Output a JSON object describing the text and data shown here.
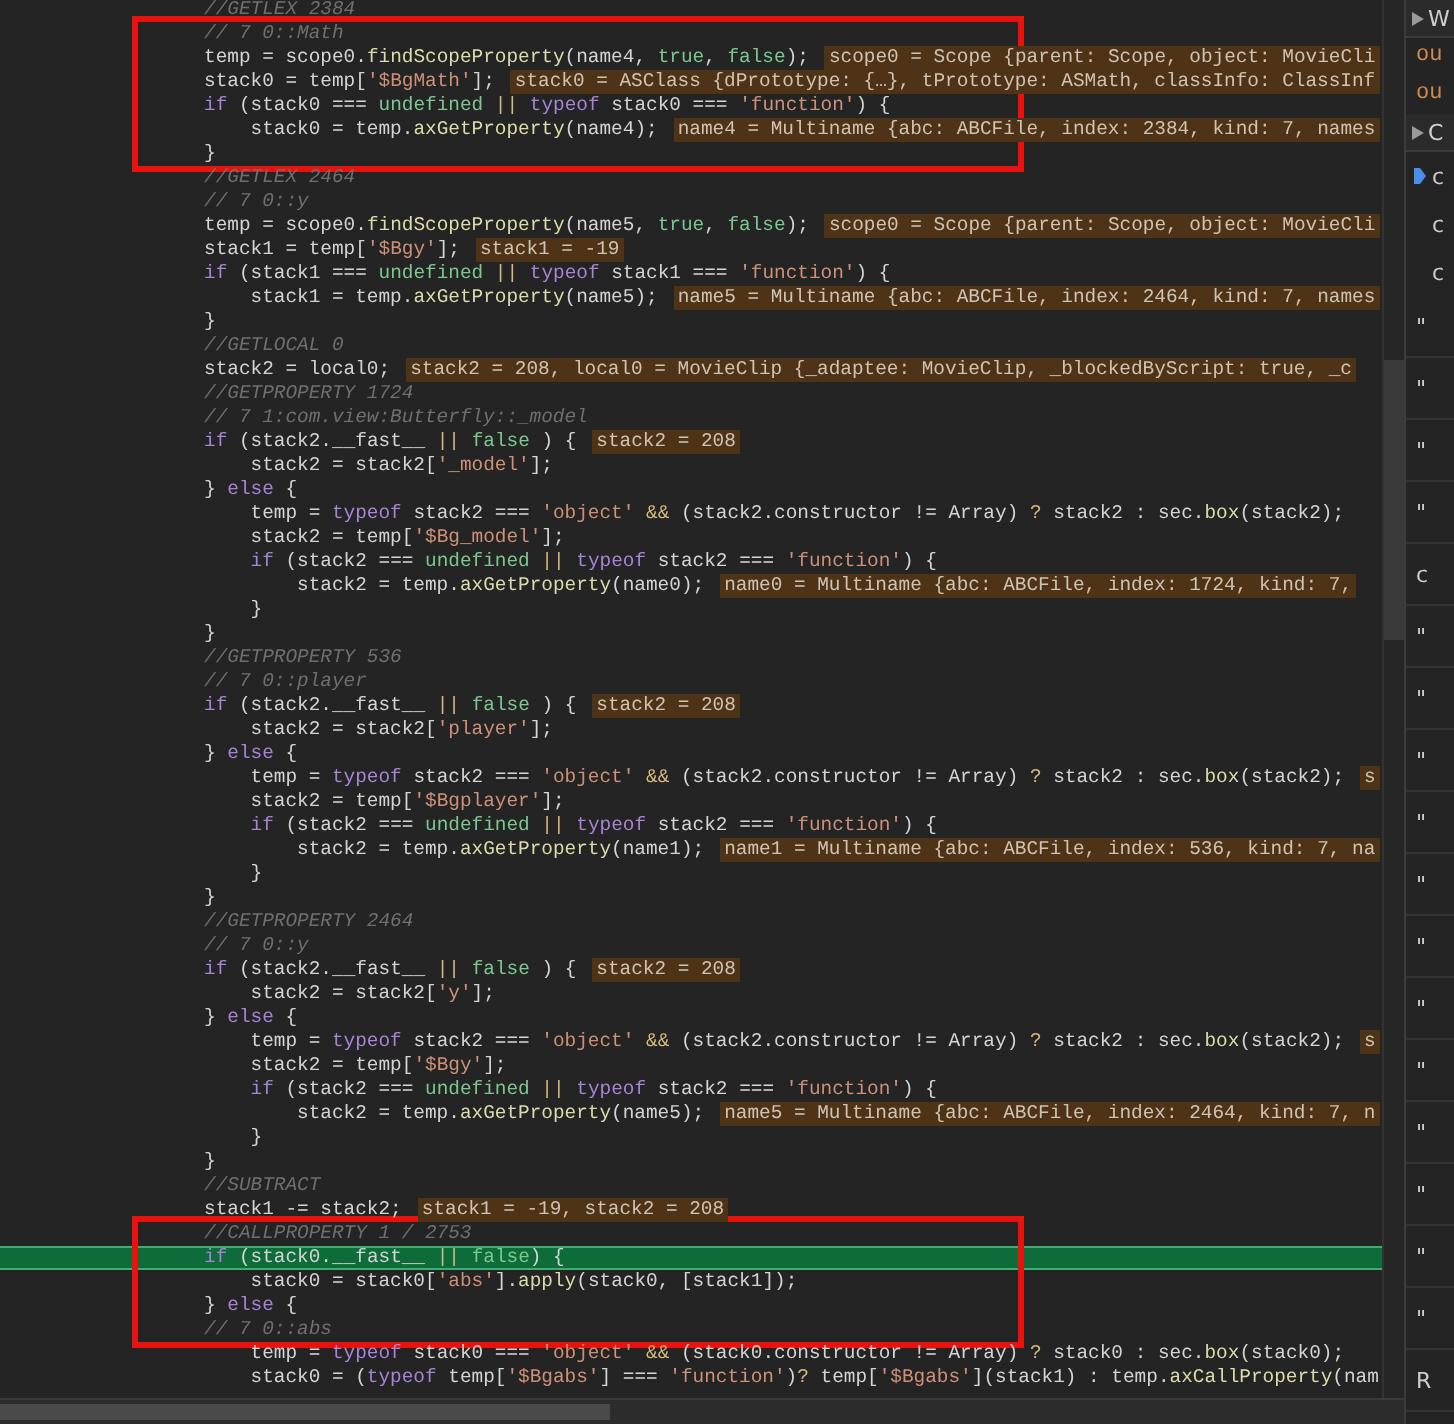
{
  "editor": {
    "segments": [
      {
        "boxed": false,
        "lines": [
          {
            "kind": "comment",
            "text": "//GETLEX 2384"
          }
        ]
      },
      {
        "boxed": true,
        "lines": [
          {
            "kind": "comment",
            "text": "// 7 0::Math"
          },
          {
            "kind": "code",
            "text": "temp = scope0.findScopeProperty(name4, true, false);",
            "value": "scope0 = Scope {parent: Scope, object: MovieCli"
          },
          {
            "kind": "code",
            "text": "stack0 = temp['$BgMath'];",
            "value": "stack0 = ASClass {dPrototype: {…}, tPrototype: ASMath, classInfo: ClassInf"
          },
          {
            "kind": "code",
            "text": "if (stack0 === undefined || typeof stack0 === 'function') {"
          },
          {
            "kind": "code",
            "text": "    stack0 = temp.axGetProperty(name4);",
            "value": "name4 = Multiname {abc: ABCFile, index: 2384, kind: 7, names"
          },
          {
            "kind": "code",
            "text": "}"
          }
        ]
      },
      {
        "boxed": false,
        "lines": [
          {
            "kind": "comment",
            "text": "//GETLEX 2464"
          },
          {
            "kind": "comment",
            "text": "// 7 0::y"
          },
          {
            "kind": "code",
            "text": "temp = scope0.findScopeProperty(name5, true, false);",
            "value": "scope0 = Scope {parent: Scope, object: MovieCli"
          },
          {
            "kind": "code",
            "text": "stack1 = temp['$Bgy'];",
            "value": "stack1 = -19"
          },
          {
            "kind": "code",
            "text": "if (stack1 === undefined || typeof stack1 === 'function') {"
          },
          {
            "kind": "code",
            "text": "    stack1 = temp.axGetProperty(name5);",
            "value": "name5 = Multiname {abc: ABCFile, index: 2464, kind: 7, names"
          },
          {
            "kind": "code",
            "text": "}"
          },
          {
            "kind": "comment",
            "text": "//GETLOCAL 0"
          },
          {
            "kind": "code",
            "text": "stack2 = local0;",
            "value": "stack2 = 208, local0 = MovieClip {_adaptee: MovieClip, _blockedByScript: true, _c"
          },
          {
            "kind": "comment",
            "text": "//GETPROPERTY 1724"
          },
          {
            "kind": "comment",
            "text": "// 7 1:com.view:Butterfly::_model"
          },
          {
            "kind": "code",
            "text": "if (stack2.__fast__ || false ) {",
            "value": "stack2 = 208"
          },
          {
            "kind": "code",
            "text": "    stack2 = stack2['_model'];"
          },
          {
            "kind": "code",
            "text": "} else {"
          },
          {
            "kind": "code",
            "text": "    temp = typeof stack2 === 'object' && (stack2.constructor != Array) ? stack2 : sec.box(stack2);"
          },
          {
            "kind": "code",
            "text": "    stack2 = temp['$Bg_model'];"
          },
          {
            "kind": "code",
            "text": "    if (stack2 === undefined || typeof stack2 === 'function') {"
          },
          {
            "kind": "code",
            "text": "        stack2 = temp.axGetProperty(name0);",
            "value": "name0 = Multiname {abc: ABCFile, index: 1724, kind: 7,"
          },
          {
            "kind": "code",
            "text": "    }"
          },
          {
            "kind": "code",
            "text": "}"
          },
          {
            "kind": "comment",
            "text": "//GETPROPERTY 536"
          },
          {
            "kind": "comment",
            "text": "// 7 0::player"
          },
          {
            "kind": "code",
            "text": "if (stack2.__fast__ || false ) {",
            "value": "stack2 = 208"
          },
          {
            "kind": "code",
            "text": "    stack2 = stack2['player'];"
          },
          {
            "kind": "code",
            "text": "} else {"
          },
          {
            "kind": "code",
            "text": "    temp = typeof stack2 === 'object' && (stack2.constructor != Array) ? stack2 : sec.box(stack2);",
            "value": "s"
          },
          {
            "kind": "code",
            "text": "    stack2 = temp['$Bgplayer'];"
          },
          {
            "kind": "code",
            "text": "    if (stack2 === undefined || typeof stack2 === 'function') {"
          },
          {
            "kind": "code",
            "text": "        stack2 = temp.axGetProperty(name1);",
            "value": "name1 = Multiname {abc: ABCFile, index: 536, kind: 7, na"
          },
          {
            "kind": "code",
            "text": "    }"
          },
          {
            "kind": "code",
            "text": "}"
          },
          {
            "kind": "comment",
            "text": "//GETPROPERTY 2464"
          },
          {
            "kind": "comment",
            "text": "// 7 0::y"
          },
          {
            "kind": "code",
            "text": "if (stack2.__fast__ || false ) {",
            "value": "stack2 = 208"
          },
          {
            "kind": "code",
            "text": "    stack2 = stack2['y'];"
          },
          {
            "kind": "code",
            "text": "} else {"
          },
          {
            "kind": "code",
            "text": "    temp = typeof stack2 === 'object' && (stack2.constructor != Array) ? stack2 : sec.box(stack2);",
            "value": "s"
          },
          {
            "kind": "code",
            "text": "    stack2 = temp['$Bgy'];"
          },
          {
            "kind": "code",
            "text": "    if (stack2 === undefined || typeof stack2 === 'function') {"
          },
          {
            "kind": "code",
            "text": "        stack2 = temp.axGetProperty(name5);",
            "value": "name5 = Multiname {abc: ABCFile, index: 2464, kind: 7, n"
          },
          {
            "kind": "code",
            "text": "    }"
          },
          {
            "kind": "code",
            "text": "}"
          },
          {
            "kind": "comment",
            "text": "//SUBTRACT"
          },
          {
            "kind": "code",
            "text": "stack1 -= stack2;",
            "value": "stack1 = -19, stack2 = 208"
          }
        ]
      },
      {
        "boxed": true,
        "lines": [
          {
            "kind": "comment",
            "text": "//CALLPROPERTY 1 / 2753"
          },
          {
            "kind": "code",
            "text": "if (stack0.__fast__ || false) {",
            "current": true
          },
          {
            "kind": "code",
            "text": "    stack0 = stack0['abs'].apply(stack0, [stack1]);"
          },
          {
            "kind": "code",
            "text": "} else {"
          },
          {
            "kind": "comment",
            "text": "// 7 0::abs"
          }
        ]
      },
      {
        "boxed": false,
        "lines": [
          {
            "kind": "code",
            "text": "    temp = typeof stack0 === 'object' && (stack0.constructor != Array) ? stack0 : sec.box(stack0);"
          },
          {
            "kind": "code",
            "text": "    stack0 = (typeof temp['$Bgabs'] === 'function')? temp['$Bgabs'](stack1) : temp.axCallProperty(nam"
          }
        ]
      }
    ]
  },
  "sidebar": {
    "items": [
      {
        "kind": "header",
        "text": "W",
        "expanded": false
      },
      {
        "kind": "watch",
        "text": "ou"
      },
      {
        "kind": "watch",
        "text": "ou"
      },
      {
        "kind": "header",
        "text": "C",
        "expanded": false
      },
      {
        "kind": "frame",
        "text": "c",
        "selected": true
      },
      {
        "kind": "frame",
        "text": "c",
        "selected": false
      },
      {
        "kind": "frame",
        "text": "c",
        "selected": false
      },
      {
        "kind": "row",
        "text": "\""
      },
      {
        "kind": "row",
        "text": "\""
      },
      {
        "kind": "row",
        "text": "\""
      },
      {
        "kind": "row",
        "text": "\""
      },
      {
        "kind": "row",
        "text": "c"
      },
      {
        "kind": "row",
        "text": "\""
      },
      {
        "kind": "row",
        "text": "\""
      },
      {
        "kind": "row",
        "text": "\""
      },
      {
        "kind": "row",
        "text": "\""
      },
      {
        "kind": "row",
        "text": "\""
      },
      {
        "kind": "row",
        "text": "\""
      },
      {
        "kind": "row",
        "text": "\""
      },
      {
        "kind": "row",
        "text": "\""
      },
      {
        "kind": "row",
        "text": "\""
      },
      {
        "kind": "row",
        "text": "\""
      },
      {
        "kind": "row",
        "text": "\""
      },
      {
        "kind": "row",
        "text": "\""
      },
      {
        "kind": "row",
        "text": "R"
      }
    ]
  }
}
